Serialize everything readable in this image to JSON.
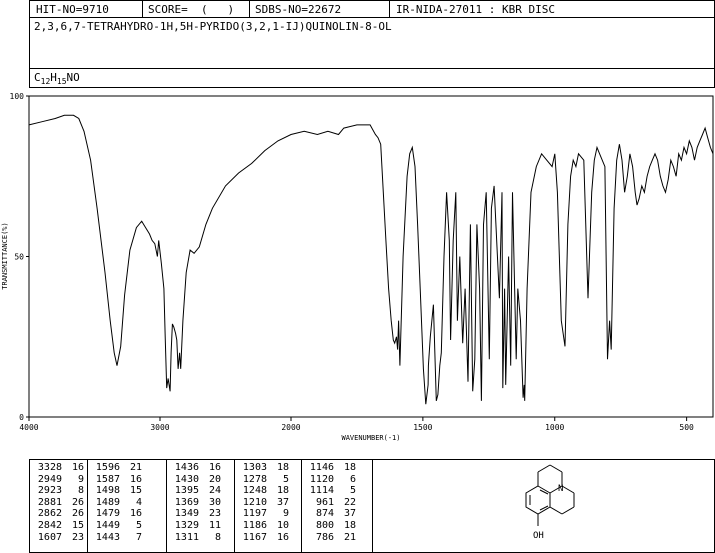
{
  "header": {
    "hit_no": "HIT-NO=9710",
    "score": "SCORE=  (   )",
    "sdbs_no": "SDBS-NO=22672",
    "ir_code": "IR-NIDA-27011 : KBR DISC",
    "compound_name": "2,3,6,7-TETRAHYDRO-1H,5H-PYRIDO(3,2,1-IJ)QUINOLIN-8-OL",
    "formula": {
      "c": "C",
      "c_sub": "12",
      "h": "H",
      "h_sub": "15",
      "rest": "NO"
    }
  },
  "chart_data": {
    "type": "line",
    "title": "",
    "xlabel": "WAVENUMBER(-1)",
    "ylabel": "TRANSMITTANCE(%)",
    "xlim": [
      4000,
      400
    ],
    "ylim": [
      0,
      100
    ],
    "x_ticks": [
      4000,
      3000,
      2000,
      1500,
      1000,
      500
    ],
    "y_ticks": [
      0,
      50,
      100
    ],
    "grid": false,
    "series": [
      {
        "name": "",
        "points": [
          [
            4000,
            91
          ],
          [
            3900,
            92
          ],
          [
            3800,
            93
          ],
          [
            3730,
            94
          ],
          [
            3660,
            94
          ],
          [
            3620,
            93
          ],
          [
            3580,
            89
          ],
          [
            3530,
            80
          ],
          [
            3480,
            65
          ],
          [
            3420,
            45
          ],
          [
            3380,
            30
          ],
          [
            3350,
            20
          ],
          [
            3328,
            16
          ],
          [
            3300,
            22
          ],
          [
            3270,
            38
          ],
          [
            3230,
            52
          ],
          [
            3180,
            59
          ],
          [
            3140,
            61
          ],
          [
            3110,
            59
          ],
          [
            3080,
            57
          ],
          [
            3060,
            55
          ],
          [
            3040,
            54
          ],
          [
            3020,
            50
          ],
          [
            3010,
            55
          ],
          [
            2990,
            48
          ],
          [
            2970,
            40
          ],
          [
            2960,
            25
          ],
          [
            2949,
            9
          ],
          [
            2938,
            12
          ],
          [
            2923,
            8
          ],
          [
            2915,
            20
          ],
          [
            2905,
            29
          ],
          [
            2895,
            28
          ],
          [
            2881,
            26
          ],
          [
            2872,
            24
          ],
          [
            2862,
            15
          ],
          [
            2850,
            20
          ],
          [
            2842,
            15
          ],
          [
            2825,
            30
          ],
          [
            2800,
            45
          ],
          [
            2770,
            52
          ],
          [
            2740,
            51
          ],
          [
            2700,
            53
          ],
          [
            2650,
            60
          ],
          [
            2600,
            65
          ],
          [
            2500,
            72
          ],
          [
            2400,
            76
          ],
          [
            2300,
            79
          ],
          [
            2200,
            83
          ],
          [
            2100,
            86
          ],
          [
            2000,
            88
          ],
          [
            1950,
            89
          ],
          [
            1900,
            88
          ],
          [
            1860,
            89
          ],
          [
            1820,
            88
          ],
          [
            1800,
            90
          ],
          [
            1750,
            91
          ],
          [
            1700,
            91
          ],
          [
            1680,
            88
          ],
          [
            1670,
            87
          ],
          [
            1660,
            85
          ],
          [
            1650,
            70
          ],
          [
            1640,
            55
          ],
          [
            1630,
            40
          ],
          [
            1620,
            30
          ],
          [
            1612,
            24
          ],
          [
            1607,
            23
          ],
          [
            1600,
            25
          ],
          [
            1596,
            21
          ],
          [
            1592,
            30
          ],
          [
            1587,
            16
          ],
          [
            1575,
            50
          ],
          [
            1560,
            75
          ],
          [
            1550,
            82
          ],
          [
            1540,
            84
          ],
          [
            1530,
            78
          ],
          [
            1520,
            60
          ],
          [
            1510,
            40
          ],
          [
            1498,
            15
          ],
          [
            1489,
            4
          ],
          [
            1480,
            10
          ],
          [
            1479,
            16
          ],
          [
            1472,
            25
          ],
          [
            1460,
            35
          ],
          [
            1449,
            5
          ],
          [
            1443,
            7
          ],
          [
            1436,
            16
          ],
          [
            1430,
            20
          ],
          [
            1420,
            50
          ],
          [
            1410,
            70
          ],
          [
            1400,
            55
          ],
          [
            1395,
            24
          ],
          [
            1385,
            55
          ],
          [
            1375,
            70
          ],
          [
            1369,
            30
          ],
          [
            1360,
            50
          ],
          [
            1349,
            23
          ],
          [
            1340,
            40
          ],
          [
            1329,
            11
          ],
          [
            1320,
            60
          ],
          [
            1311,
            8
          ],
          [
            1303,
            18
          ],
          [
            1295,
            60
          ],
          [
            1285,
            40
          ],
          [
            1278,
            5
          ],
          [
            1270,
            60
          ],
          [
            1260,
            70
          ],
          [
            1248,
            18
          ],
          [
            1240,
            65
          ],
          [
            1230,
            72
          ],
          [
            1210,
            37
          ],
          [
            1200,
            70
          ],
          [
            1197,
            9
          ],
          [
            1190,
            40
          ],
          [
            1186,
            10
          ],
          [
            1175,
            50
          ],
          [
            1167,
            16
          ],
          [
            1160,
            70
          ],
          [
            1146,
            18
          ],
          [
            1140,
            40
          ],
          [
            1130,
            30
          ],
          [
            1120,
            6
          ],
          [
            1116,
            10
          ],
          [
            1114,
            5
          ],
          [
            1105,
            40
          ],
          [
            1090,
            70
          ],
          [
            1070,
            78
          ],
          [
            1050,
            82
          ],
          [
            1030,
            80
          ],
          [
            1010,
            78
          ],
          [
            1000,
            82
          ],
          [
            990,
            70
          ],
          [
            975,
            30
          ],
          [
            961,
            22
          ],
          [
            950,
            60
          ],
          [
            940,
            75
          ],
          [
            930,
            80
          ],
          [
            920,
            78
          ],
          [
            910,
            82
          ],
          [
            890,
            80
          ],
          [
            874,
            37
          ],
          [
            860,
            70
          ],
          [
            850,
            80
          ],
          [
            840,
            84
          ],
          [
            830,
            82
          ],
          [
            810,
            78
          ],
          [
            800,
            18
          ],
          [
            792,
            30
          ],
          [
            786,
            21
          ],
          [
            775,
            65
          ],
          [
            765,
            80
          ],
          [
            755,
            85
          ],
          [
            745,
            80
          ],
          [
            735,
            70
          ],
          [
            725,
            75
          ],
          [
            715,
            82
          ],
          [
            705,
            78
          ],
          [
            695,
            70
          ],
          [
            688,
            66
          ],
          [
            680,
            68
          ],
          [
            670,
            72
          ],
          [
            660,
            70
          ],
          [
            650,
            75
          ],
          [
            640,
            78
          ],
          [
            630,
            80
          ],
          [
            620,
            82
          ],
          [
            610,
            80
          ],
          [
            600,
            75
          ],
          [
            590,
            72
          ],
          [
            580,
            70
          ],
          [
            570,
            74
          ],
          [
            560,
            80
          ],
          [
            550,
            78
          ],
          [
            540,
            75
          ],
          [
            530,
            82
          ],
          [
            520,
            80
          ],
          [
            510,
            84
          ],
          [
            500,
            82
          ],
          [
            490,
            86
          ],
          [
            480,
            84
          ],
          [
            470,
            80
          ],
          [
            460,
            84
          ],
          [
            450,
            86
          ],
          [
            440,
            88
          ],
          [
            430,
            90
          ],
          [
            420,
            87
          ],
          [
            410,
            84
          ],
          [
            400,
            82
          ]
        ]
      }
    ]
  },
  "peak_table": [
    [
      [
        3328,
        16
      ],
      [
        2949,
        9
      ],
      [
        2923,
        8
      ],
      [
        2881,
        26
      ],
      [
        2862,
        26
      ],
      [
        2842,
        15
      ],
      [
        1607,
        23
      ]
    ],
    [
      [
        1596,
        21
      ],
      [
        1587,
        16
      ],
      [
        1498,
        15
      ],
      [
        1489,
        4
      ],
      [
        1479,
        16
      ],
      [
        1449,
        5
      ],
      [
        1443,
        7
      ]
    ],
    [
      [
        1436,
        16
      ],
      [
        1430,
        20
      ],
      [
        1395,
        24
      ],
      [
        1369,
        30
      ],
      [
        1349,
        23
      ],
      [
        1329,
        11
      ],
      [
        1311,
        8
      ]
    ],
    [
      [
        1303,
        18
      ],
      [
        1278,
        5
      ],
      [
        1248,
        18
      ],
      [
        1210,
        37
      ],
      [
        1197,
        9
      ],
      [
        1186,
        10
      ],
      [
        1167,
        16
      ]
    ],
    [
      [
        1146,
        18
      ],
      [
        1120,
        6
      ],
      [
        1114,
        5
      ],
      [
        961,
        22
      ],
      [
        874,
        37
      ],
      [
        800,
        18
      ],
      [
        786,
        21
      ]
    ]
  ],
  "structure": {
    "label": "OH",
    "n_label": "N"
  }
}
